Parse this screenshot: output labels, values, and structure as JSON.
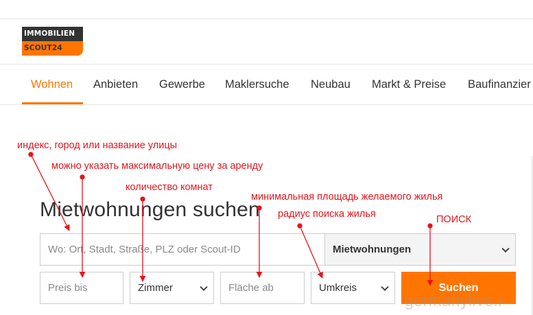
{
  "logo": {
    "line1": "IMMOBILIEN",
    "line2": "SCOUT24"
  },
  "nav": [
    {
      "label": "Wohnen",
      "active": true
    },
    {
      "label": "Anbieten"
    },
    {
      "label": "Gewerbe"
    },
    {
      "label": "Maklersuche"
    },
    {
      "label": "Neubau"
    },
    {
      "label": "Markt & Preise"
    },
    {
      "label": "Baufinanzier"
    }
  ],
  "search": {
    "title": "Mietwohnungen suchen",
    "location_placeholder": "Wo: Ort, Stadt, Straße, PLZ oder Scout-ID",
    "type_select": "Mietwohnungen",
    "price_placeholder": "Preis bis",
    "rooms_select": "Zimmer",
    "area_placeholder": "Fläche ab",
    "radius_select": "Umkreis",
    "submit_label": "Suchen"
  },
  "annotations": {
    "location": "индекс, город или название улицы",
    "price": "можно указать максимальную цену за аренду",
    "rooms": "количество комнат",
    "area": "минимальная площадь желаемого жилья",
    "radius": "радиус поиска жилья",
    "submit": "ПОИСК"
  },
  "watermark": "germanylive.r",
  "colors": {
    "accent": "#ff7500",
    "annotation": "#e8141c",
    "logo_dark": "#333333"
  }
}
